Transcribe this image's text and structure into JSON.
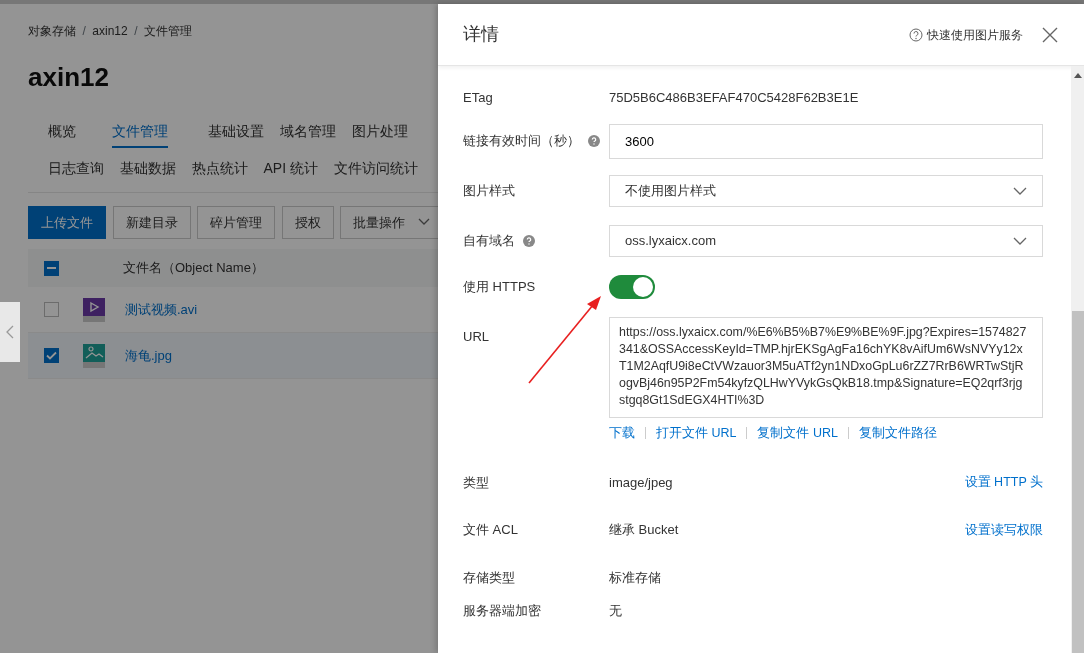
{
  "breadcrumb": [
    {
      "kind": "link",
      "text": "对象存储"
    },
    {
      "kind": "separator",
      "text": "/"
    },
    {
      "kind": "link",
      "text": "axin12"
    },
    {
      "kind": "separator",
      "text": "/"
    },
    {
      "kind": "current",
      "text": "文件管理"
    }
  ],
  "bucket_title": "axin12",
  "nav_tabs": [
    {
      "label": "概览",
      "selected": false
    },
    {
      "label": "文件管理",
      "selected": true
    },
    {
      "label": "基础设置",
      "selected": false
    },
    {
      "label": "域名管理",
      "selected": false
    },
    {
      "label": "图片处理",
      "selected": false
    },
    {
      "label": "日志查询",
      "selected": false
    },
    {
      "label": "基础数据",
      "selected": false
    },
    {
      "label": "热点统计",
      "selected": false
    },
    {
      "label": "API 统计",
      "selected": false
    },
    {
      "label": "文件访问统计",
      "selected": false
    }
  ],
  "toolbar_buttons": [
    {
      "label": "上传文件",
      "kind": "primary"
    },
    {
      "label": "新建目录",
      "kind": "default"
    },
    {
      "label": "碎片管理",
      "kind": "default"
    },
    {
      "label": "授权",
      "kind": "default"
    },
    {
      "label": "批量操作",
      "kind": "dropdown"
    }
  ],
  "file_table": {
    "header": "文件名（Object Name）",
    "header_indeterminate": true,
    "rows": [
      {
        "name": "测试视频.avi",
        "kind": "video",
        "checked": false
      },
      {
        "name": "海龟.jpg",
        "kind": "image",
        "checked": true
      }
    ]
  },
  "drawer": {
    "title": "详情",
    "help_link": "快速使用图片服务",
    "fields": [
      {
        "kind": "text",
        "label": "ETag",
        "value": "75D5B6C486B3EFAF470C5428F62B3E1E"
      },
      {
        "kind": "input",
        "label": "链接有效时间（秒）",
        "help": true,
        "value": "3600"
      },
      {
        "kind": "select",
        "label": "图片样式",
        "help": false,
        "value": "不使用图片样式"
      },
      {
        "kind": "select",
        "label": "自有域名",
        "help": true,
        "value": "oss.lyxaicx.com"
      },
      {
        "kind": "switch",
        "label": "使用 HTTPS",
        "on": true
      },
      {
        "kind": "url",
        "label": "URL",
        "value": "https://oss.lyxaicx.com/%E6%B5%B7%E9%BE%9F.jpg?Expires=1574827341&OSSAccessKeyId=TMP.hjrEKSgAgFa16chYK8vAifUm6WsNVYy12xT1M2AqfU9i8eCtVWzauor3M5uATf2yn1NDxoGpLu6rZZ7RrB6WRTwStjRogvBj46n95P2Fm54kyfzQLHwYVykGsQkB18.tmp&Signature=EQ2qrf3rjgstgq8Gt1SdEGX4HTI%3D",
        "links": [
          "下载",
          "打开文件 URL",
          "复制文件 URL",
          "复制文件路径"
        ]
      },
      {
        "kind": "text",
        "label": "类型",
        "value": "image/jpeg",
        "action": "设置 HTTP 头"
      },
      {
        "kind": "text",
        "label": "文件 ACL",
        "value": "继承 Bucket",
        "action": "设置读写权限"
      },
      {
        "kind": "text",
        "label": "存储类型",
        "value": "标准存储"
      },
      {
        "kind": "text",
        "label": "服务器端加密",
        "value": "无"
      }
    ]
  }
}
